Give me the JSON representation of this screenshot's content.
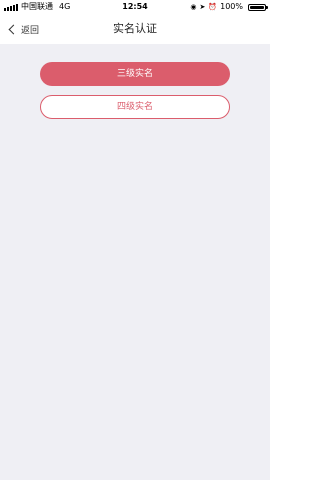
{
  "status_bar": {
    "carrier": "中国联通",
    "network": "4G",
    "time": "12:54",
    "battery_text": "100%",
    "battery_level": 1.0,
    "icons": [
      "location-icon",
      "alarm-icon",
      "orientation-lock-icon"
    ]
  },
  "nav": {
    "back_label": "返回",
    "title": "实名认证"
  },
  "buttons": {
    "level3_label": "三级实名",
    "level4_label": "四级实名"
  },
  "colors": {
    "accent": "#db5d6c",
    "background": "#efeff4"
  }
}
